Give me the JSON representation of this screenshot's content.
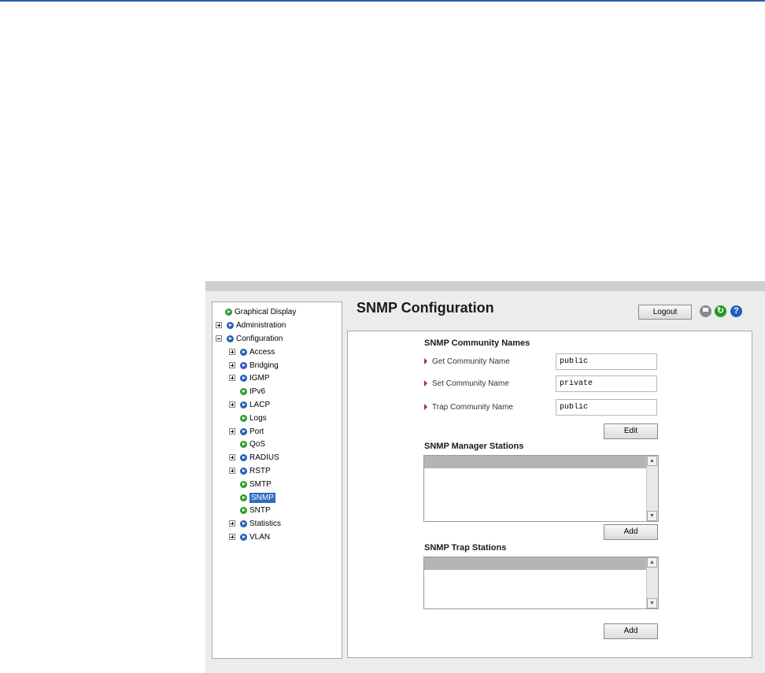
{
  "nav": {
    "items": [
      {
        "label": "Graphical Display",
        "bullet": "green"
      },
      {
        "label": "Administration",
        "expander": "plus",
        "bullet": "blue"
      },
      {
        "label": "Configuration",
        "expander": "minus",
        "bullet": "blue"
      },
      {
        "label": "Access",
        "expander": "plus",
        "bullet": "blue"
      },
      {
        "label": "Bridging",
        "expander": "plus",
        "bullet": "blue"
      },
      {
        "label": "IGMP",
        "expander": "plus",
        "bullet": "blue"
      },
      {
        "label": "IPv6",
        "bullet": "green"
      },
      {
        "label": "LACP",
        "expander": "plus",
        "bullet": "blue"
      },
      {
        "label": "Logs",
        "bullet": "green"
      },
      {
        "label": "Port",
        "expander": "plus",
        "bullet": "blue"
      },
      {
        "label": "QoS",
        "bullet": "green"
      },
      {
        "label": "RADIUS",
        "expander": "plus",
        "bullet": "blue"
      },
      {
        "label": "RSTP",
        "expander": "plus",
        "bullet": "blue"
      },
      {
        "label": "SMTP",
        "bullet": "green"
      },
      {
        "label": "SNMP",
        "bullet": "green",
        "selected": true
      },
      {
        "label": "SNTP",
        "bullet": "green"
      },
      {
        "label": "Statistics",
        "expander": "plus",
        "bullet": "blue"
      },
      {
        "label": "VLAN",
        "expander": "plus",
        "bullet": "blue"
      }
    ]
  },
  "header": {
    "title": "SNMP Configuration",
    "logout_label": "Logout",
    "icons": [
      "disk-icon",
      "refresh-icon",
      "help-icon"
    ],
    "help_glyph": "?"
  },
  "community": {
    "title": "SNMP Community Names",
    "get_label": "Get Community Name",
    "get_value": "public",
    "set_label": "Set Community Name",
    "set_value": "private",
    "trap_label": "Trap Community Name",
    "trap_value": "public",
    "edit_label": "Edit"
  },
  "managers": {
    "title": "SNMP Manager Stations",
    "add_label": "Add"
  },
  "traps": {
    "title": "SNMP Trap Stations",
    "add_label": "Add"
  },
  "scroll": {
    "up": "▲",
    "down": "▼"
  },
  "colors": {
    "accent": "#316ac5",
    "topRule": "#2e5fa3",
    "bulletGreen": "#2e9d2e",
    "bulletBlue": "#2a5fb5",
    "arrowRed": "#c0261c"
  }
}
